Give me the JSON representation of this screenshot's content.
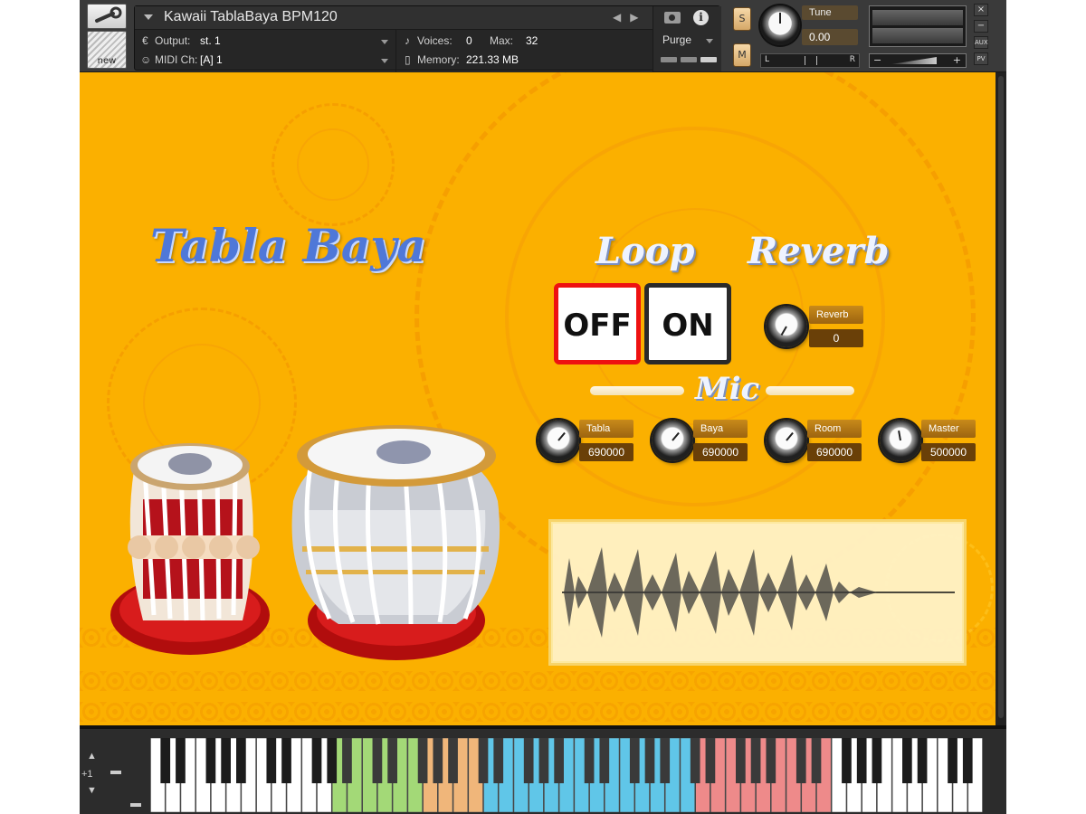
{
  "header": {
    "instrument_name": "Kawaii TablaBaya BPM120",
    "output_label": "Output:",
    "output_value": "st. 1",
    "voices_label": "Voices:",
    "voices_value": "0",
    "max_label": "Max:",
    "max_value": "32",
    "midi_label": "MIDI Ch:",
    "midi_value": "[A]  1",
    "memory_label": "Memory:",
    "memory_value": "221.33 MB",
    "purge_label": "Purge",
    "new_label": "new",
    "solo_label": "S",
    "mute_label": "M",
    "tune_label": "Tune",
    "tune_value": "0.00",
    "pan_left": "L",
    "pan_right": "R",
    "vol_minus": "−",
    "vol_plus": "+",
    "aux_label": "AUX",
    "pv_label": "PV",
    "close_glyph": "×",
    "min_glyph": "−"
  },
  "main": {
    "title": "Tabla Baya",
    "loop_title": "Loop",
    "reverb_title": "Reverb",
    "mic_title": "Mic",
    "loop_off_label": "OFF",
    "loop_on_label": "ON",
    "reverb_knob": {
      "label": "Reverb",
      "value": "0"
    },
    "mic_knobs": [
      {
        "label": "Tabla",
        "value": "690000"
      },
      {
        "label": "Baya",
        "value": "690000"
      },
      {
        "label": "Room",
        "value": "690000"
      },
      {
        "label": "Master",
        "value": "500000"
      }
    ]
  },
  "keyboard": {
    "octave_label": "+1",
    "zones": [
      {
        "name": "green",
        "color": "#a3d977"
      },
      {
        "name": "orange",
        "color": "#f0b67a"
      },
      {
        "name": "blue",
        "color": "#60c6e8"
      },
      {
        "name": "red",
        "color": "#ee8a8a"
      }
    ]
  },
  "colors": {
    "panel_bg": "#fbb000",
    "accent_red": "#ee1111",
    "title_blue": "#4f78d8"
  }
}
